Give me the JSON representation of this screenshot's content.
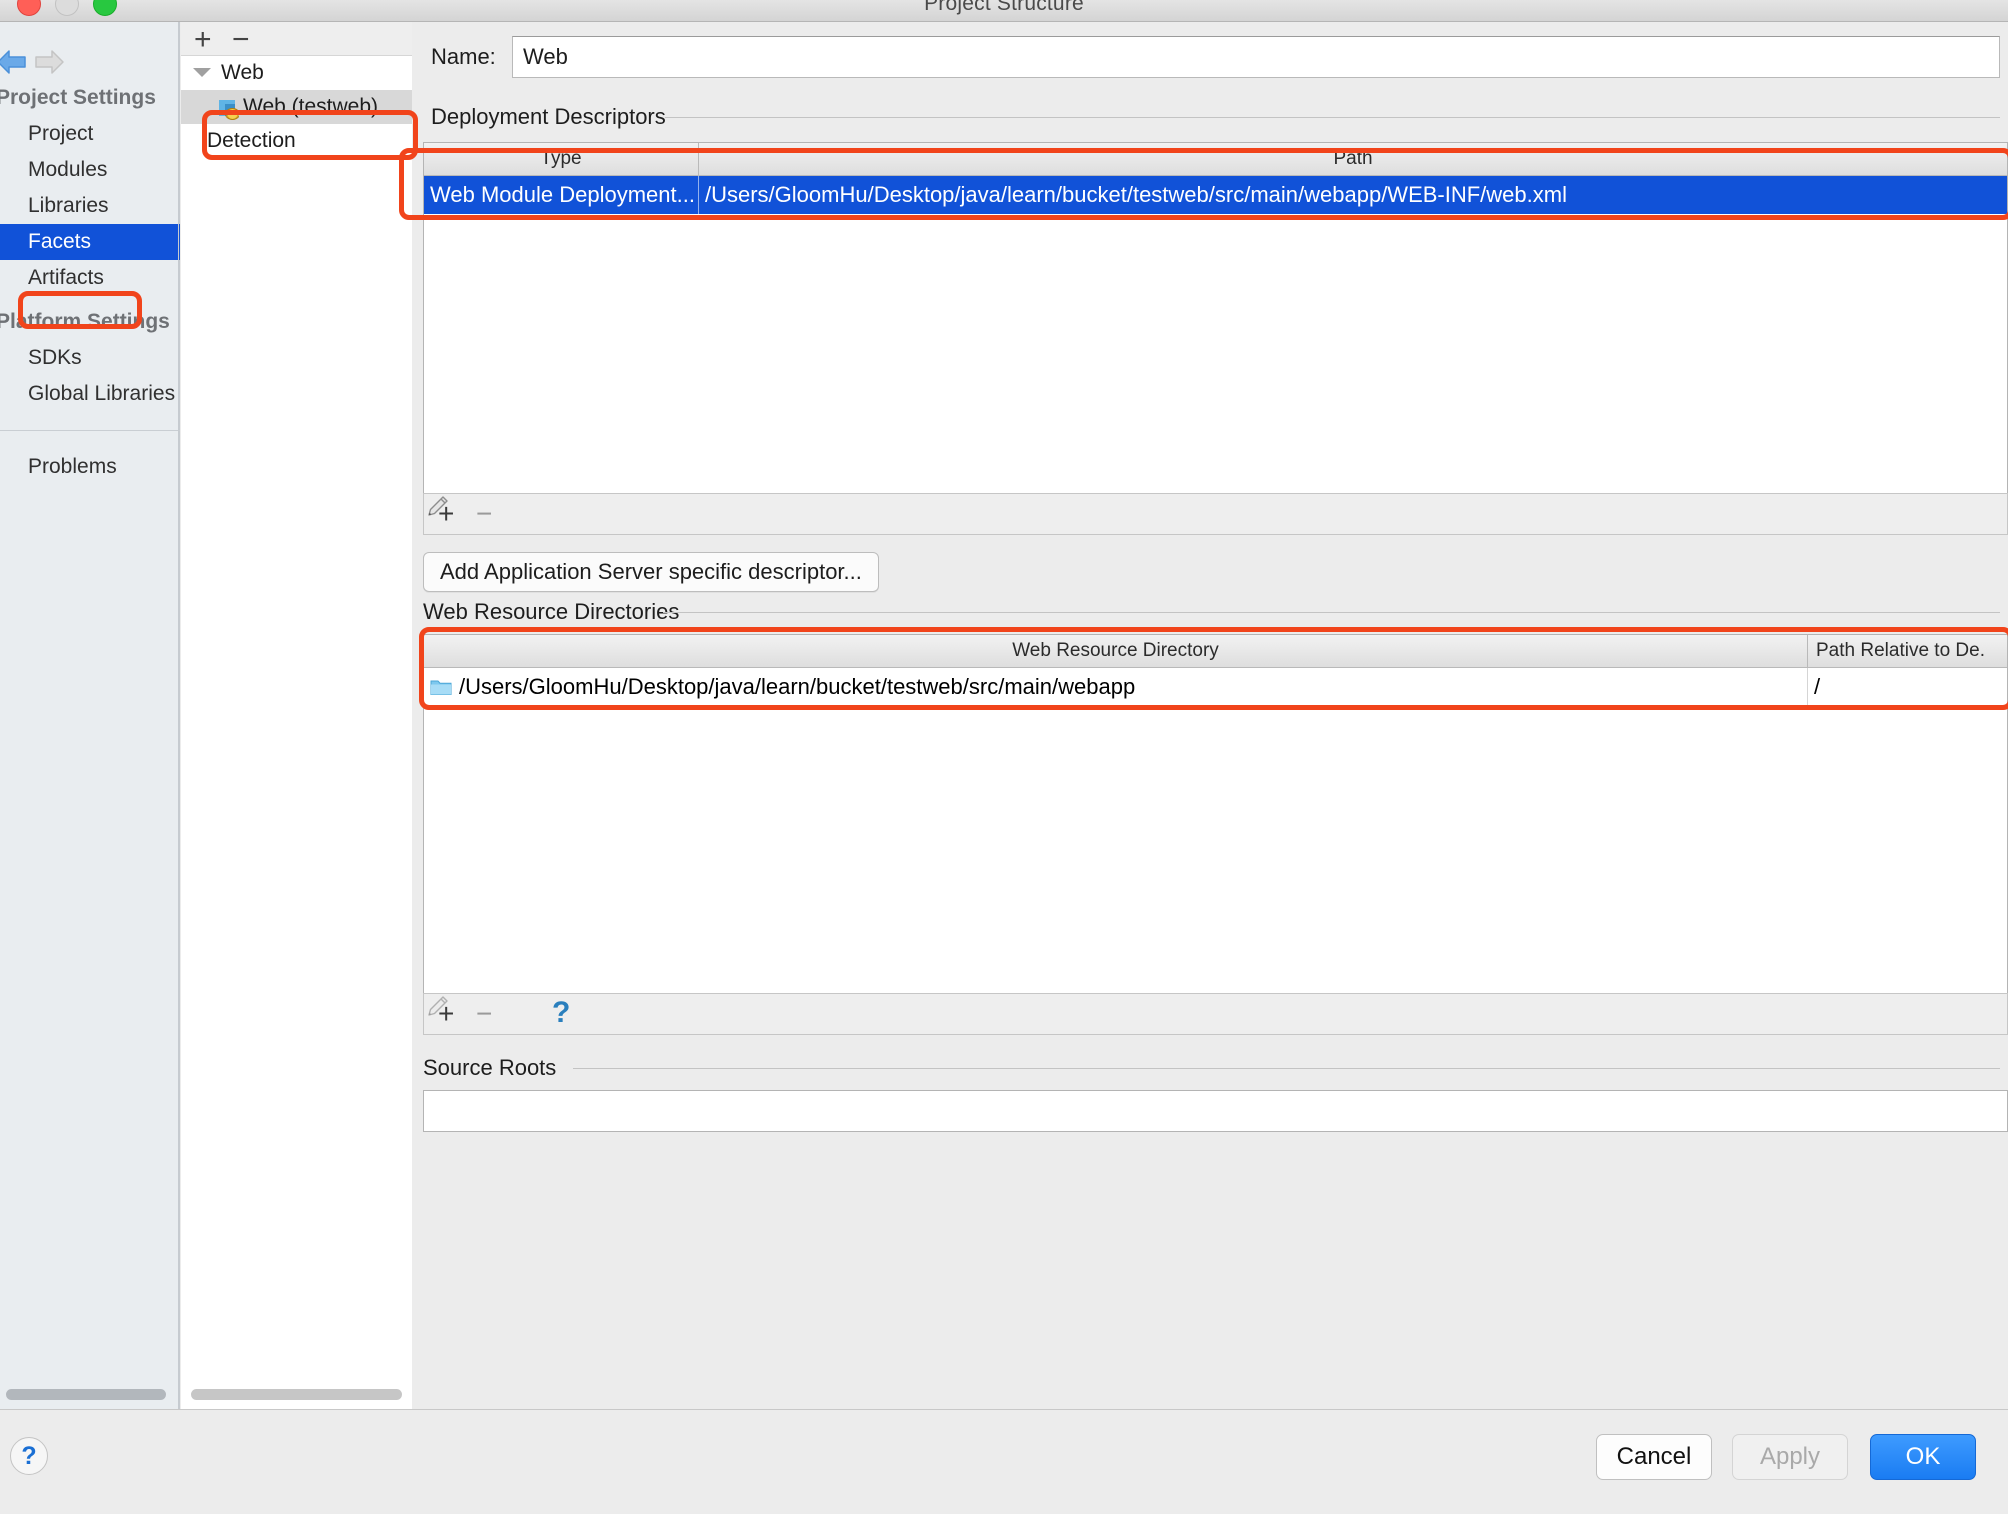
{
  "window": {
    "title": "Project Structure",
    "traffic_lights": [
      "close",
      "minimize",
      "maximize"
    ]
  },
  "sidebar": {
    "groups": [
      {
        "label": "Project Settings",
        "items": [
          {
            "label": "Project",
            "selected": false
          },
          {
            "label": "Modules",
            "selected": false
          },
          {
            "label": "Libraries",
            "selected": false
          },
          {
            "label": "Facets",
            "selected": true
          },
          {
            "label": "Artifacts",
            "selected": false
          }
        ]
      },
      {
        "label": "Platform Settings",
        "items": [
          {
            "label": "SDKs",
            "selected": false
          },
          {
            "label": "Global Libraries",
            "selected": false
          }
        ]
      }
    ],
    "extra_items": [
      {
        "label": "Problems",
        "selected": false
      }
    ]
  },
  "tree": {
    "toolbar": {
      "add_label": "+",
      "remove_label": "−"
    },
    "root": {
      "label": "Web",
      "expanded": true
    },
    "child": {
      "label": "Web (testweb)",
      "selected": true,
      "icon": "web-facet-icon"
    },
    "detection": {
      "label": "Detection"
    }
  },
  "main": {
    "name": {
      "label": "Name:",
      "value": "Web",
      "placeholder": ""
    },
    "deployment_descriptors": {
      "title": "Deployment Descriptors",
      "columns": [
        "Type",
        "Path"
      ],
      "rows": [
        {
          "type": "Web Module Deployment...",
          "path": "/Users/GloomHu/Desktop/java/learn/bucket/testweb/src/main/webapp/WEB-INF/web.xml",
          "selected": true
        }
      ],
      "toolbar": {
        "add": "+",
        "remove": "−",
        "edit": "pencil-icon"
      },
      "add_descriptor_button": "Add Application Server specific descriptor..."
    },
    "web_resource_directories": {
      "title": "Web Resource Directories",
      "columns": [
        "Web Resource Directory",
        "Path Relative to De."
      ],
      "rows": [
        {
          "directory": "/Users/GloomHu/Desktop/java/learn/bucket/testweb/src/main/webapp",
          "relative_path": "/",
          "icon": "folder-icon"
        }
      ],
      "toolbar": {
        "add": "+",
        "remove": "−",
        "edit": "pencil-icon",
        "help": "?"
      }
    },
    "source_roots": {
      "title": "Source Roots",
      "rows": []
    }
  },
  "footer": {
    "help_label": "?",
    "cancel_label": "Cancel",
    "apply_label": "Apply",
    "ok_label": "OK"
  },
  "colors": {
    "selection_blue": "#1152d8",
    "annotation_red": "#f1441b",
    "ok_button_blue": "#1a7cf2"
  }
}
